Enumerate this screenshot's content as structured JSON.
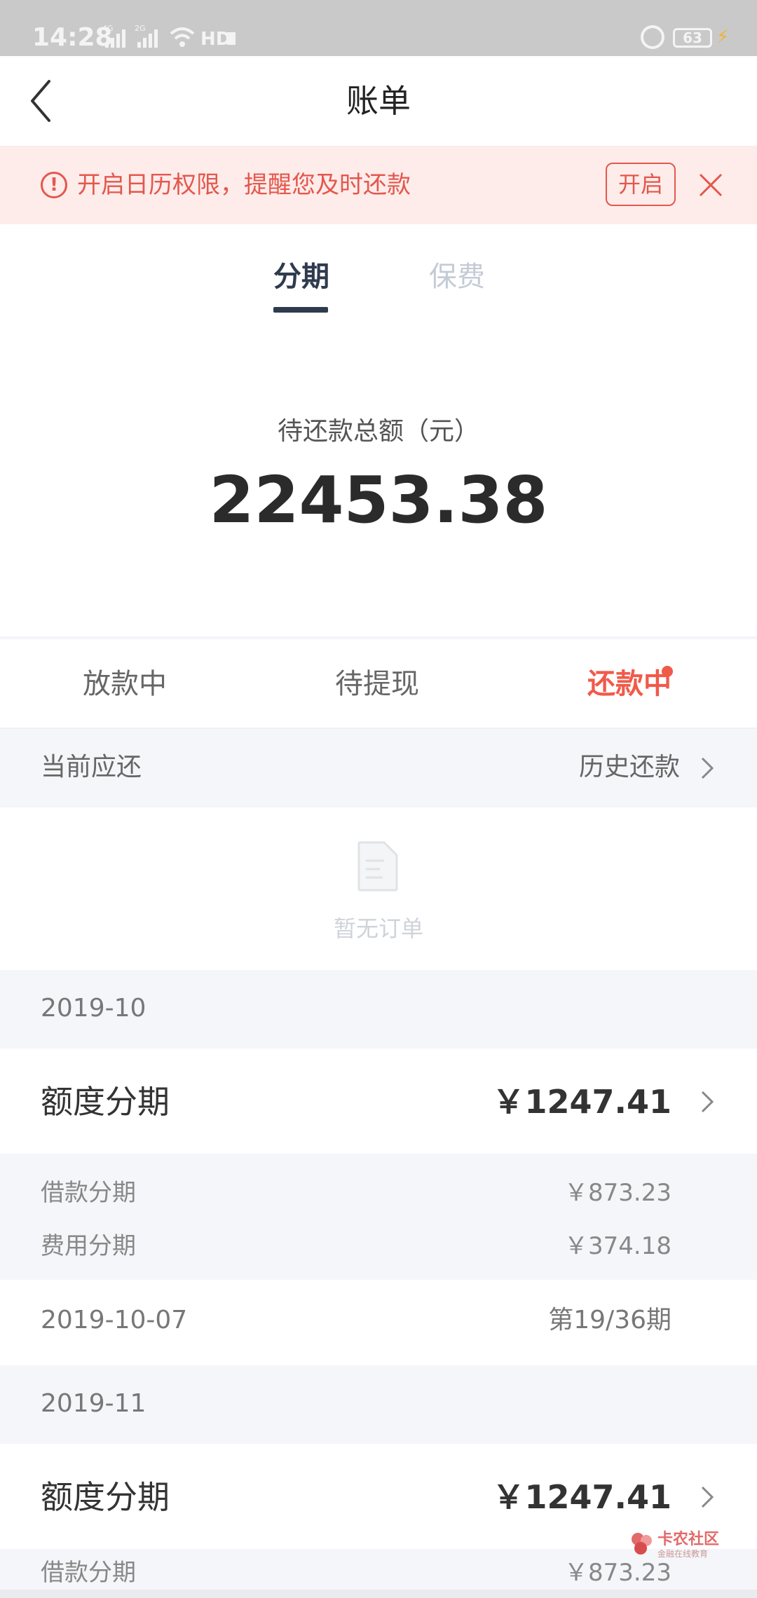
{
  "status_bar": {
    "time": "14:28",
    "network1": "4G",
    "network2": "2G",
    "hd": "HD",
    "battery": "63"
  },
  "nav": {
    "title": "账单"
  },
  "banner": {
    "text": "开启日历权限，提醒您及时还款",
    "button": "开启"
  },
  "tabs": {
    "active": "分期",
    "inactive": "保费"
  },
  "total": {
    "label": "待还款总额（元）",
    "amount": "22453.38"
  },
  "status_tabs": {
    "lending": "放款中",
    "pending": "待提现",
    "repaying": "还款中"
  },
  "current": {
    "left": "当前应还",
    "right": "历史还款"
  },
  "empty": {
    "message": "暂无订单"
  },
  "months": [
    {
      "month": "2019-10",
      "card": {
        "name": "额度分期",
        "amount": "￥1247.41",
        "rows": [
          {
            "label": "借款分期",
            "value": "￥873.23"
          },
          {
            "label": "费用分期",
            "value": "￥374.18"
          }
        ],
        "date": "2019-10-07",
        "period": "第19/36期"
      }
    },
    {
      "month": "2019-11",
      "card": {
        "name": "额度分期",
        "amount": "￥1247.41",
        "rows": [
          {
            "label": "借款分期",
            "value": "￥873.23"
          }
        ]
      }
    }
  ],
  "watermark": {
    "title": "卡农社区",
    "subtitle": "金融在线教育"
  },
  "colors": {
    "accent_red": "#e4574d",
    "tab_dark": "#2f3a4d",
    "tab_light": "#c5cbd6",
    "section_bg": "#f4f6f9"
  }
}
